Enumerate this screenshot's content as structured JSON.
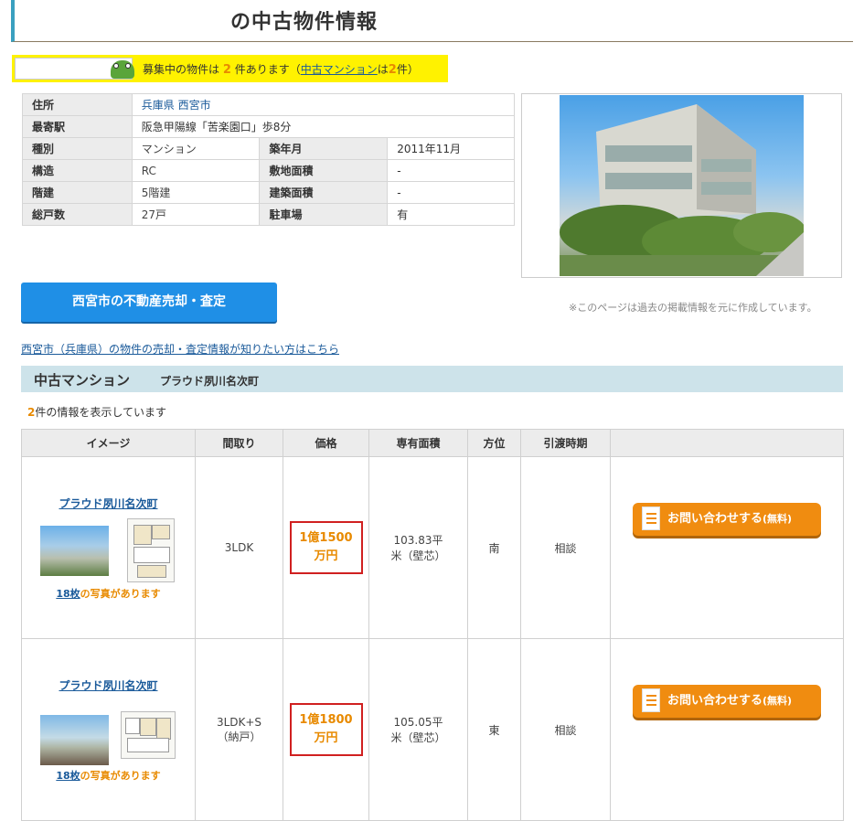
{
  "header": {
    "title": "の中古物件情報"
  },
  "notice": {
    "prefix": "募集中の物件は",
    "count": "2",
    "mid": "件あります（",
    "link": "中古マンション",
    "wa": "は",
    "link_count": "2",
    "suffix": "件）"
  },
  "info": {
    "address_label": "住所",
    "address_value": "兵庫県 西宮市",
    "station_label": "最寄駅",
    "station_value": "阪急甲陽線「苦楽園口」歩8分",
    "type_label": "種別",
    "type_value": "マンション",
    "built_label": "築年月",
    "built_value": "2011年11月",
    "structure_label": "構造",
    "structure_value": "RC",
    "land_label": "敷地面積",
    "land_value": "-",
    "floors_label": "階建",
    "floors_value": "5階建",
    "building_area_label": "建築面積",
    "building_area_value": "-",
    "units_label": "総戸数",
    "units_value": "27戸",
    "parking_label": "駐車場",
    "parking_value": "有"
  },
  "cta": {
    "label": "西宮市の不動産売却・査定"
  },
  "disclaimer": "※このページは過去の掲載情報を元に作成しています。",
  "info_link": "西宮市（兵庫県）の物件の売却・査定情報が知りたい方はこちら",
  "section": {
    "category": "中古マンション",
    "name": "プラウド夙川名次町"
  },
  "count_line": {
    "count": "2",
    "text": "件の情報を表示しています"
  },
  "table": {
    "headers": [
      "イメージ",
      "間取り",
      "価格",
      "専有面積",
      "方位",
      "引渡時期",
      ""
    ],
    "rows": [
      {
        "name": "プラウド夙川名次町",
        "photos": "18枚",
        "photos_suffix": "の写真があります",
        "layout_line1": "3LDK",
        "layout_line2": "",
        "price_line1": "1億1500",
        "price_line2": "万円",
        "area_line1": "103.83平",
        "area_line2": "米（壁芯）",
        "direction": "南",
        "handover": "相談",
        "contact": "お問い合わせする",
        "contact_free": "(無料)"
      },
      {
        "name": "プラウド夙川名次町",
        "photos": "18枚",
        "photos_suffix": "の写真があります",
        "layout_line1": "3LDK+S",
        "layout_line2": "（納戸）",
        "price_line1": "1億1800",
        "price_line2": "万円",
        "area_line1": "105.05平",
        "area_line2": "米（壁芯）",
        "direction": "東",
        "handover": "相談",
        "contact": "お問い合わせする",
        "contact_free": "(無料)"
      }
    ]
  },
  "colors": {
    "accent_blue": "#1f8fe6",
    "price_orange": "#e88a00",
    "highlight_yellow": "#fff200",
    "section_bg": "#cde3ea"
  }
}
